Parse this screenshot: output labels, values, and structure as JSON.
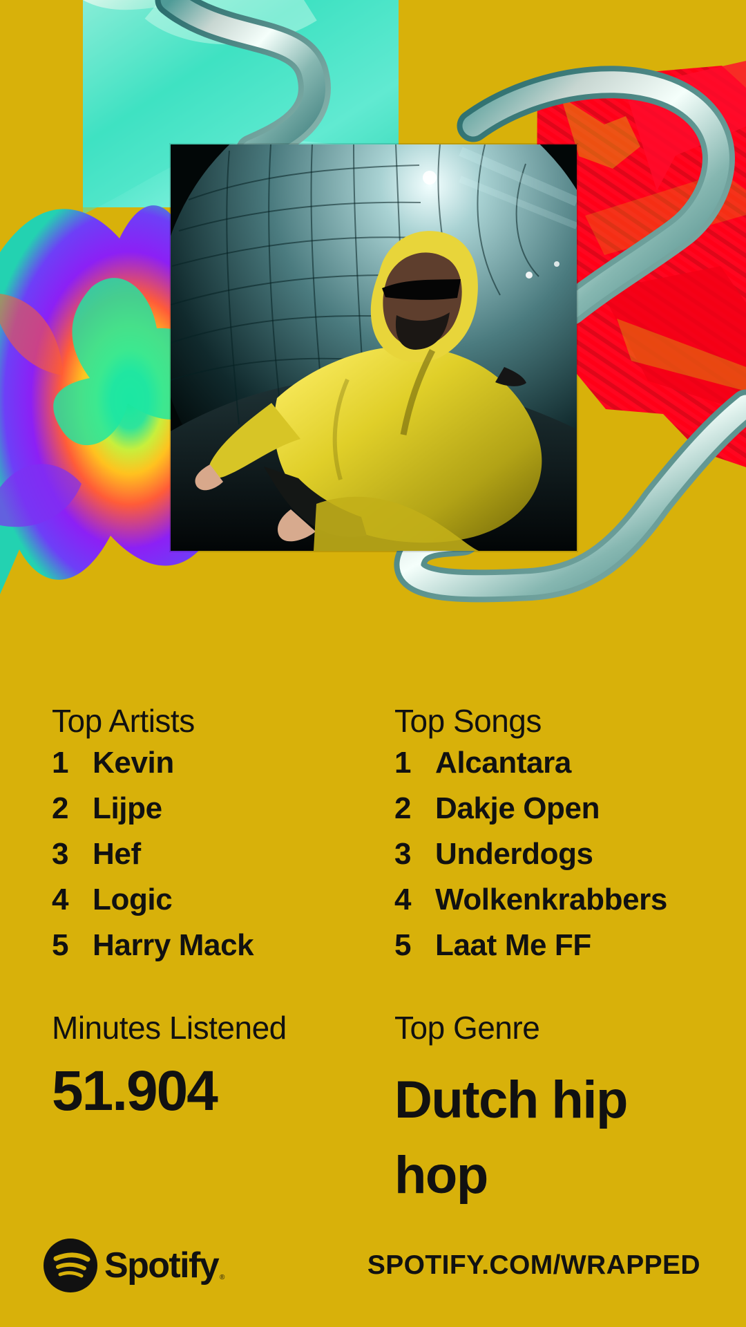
{
  "background_color": "#d8b10a",
  "cover": {
    "icon": "hooded-artist-photo"
  },
  "top_artists": {
    "title": "Top Artists",
    "items": [
      {
        "rank": "1",
        "name": "Kevin"
      },
      {
        "rank": "2",
        "name": "Lijpe"
      },
      {
        "rank": "3",
        "name": "Hef"
      },
      {
        "rank": "4",
        "name": "Logic"
      },
      {
        "rank": "5",
        "name": "Harry Mack"
      }
    ]
  },
  "top_songs": {
    "title": "Top Songs",
    "items": [
      {
        "rank": "1",
        "name": "Alcantara"
      },
      {
        "rank": "2",
        "name": "Dakje Open"
      },
      {
        "rank": "3",
        "name": "Underdogs"
      },
      {
        "rank": "4",
        "name": "Wolkenkrabbers"
      },
      {
        "rank": "5",
        "name": "Laat Me FF"
      }
    ]
  },
  "minutes": {
    "label": "Minutes Listened",
    "value": "51.904"
  },
  "genre": {
    "label": "Top Genre",
    "value": "Dutch hip hop"
  },
  "footer": {
    "brand": "Spotify",
    "trademark": "®",
    "url": "SPOTIFY.COM/WRAPPED",
    "logo_icon": "spotify-logo-icon"
  }
}
